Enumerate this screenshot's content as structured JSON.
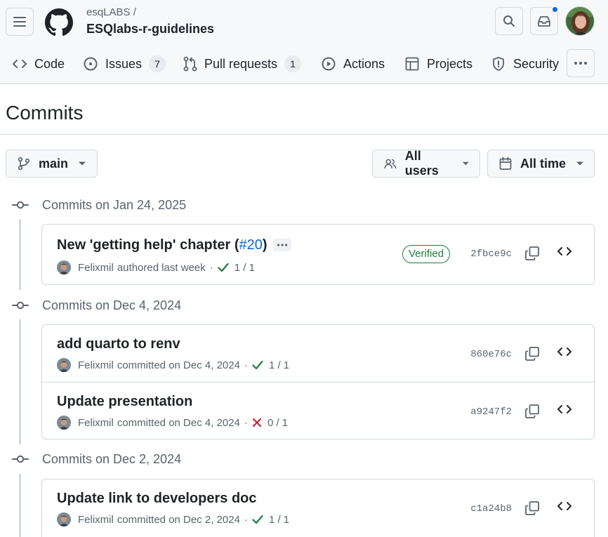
{
  "header": {
    "owner": "esqLABS /",
    "repo": "ESQlabs-r-guidelines"
  },
  "nav": {
    "code": "Code",
    "issues": "Issues",
    "issues_count": "7",
    "pulls": "Pull requests",
    "pulls_count": "1",
    "actions": "Actions",
    "projects": "Projects",
    "security": "Security"
  },
  "page": {
    "title": "Commits"
  },
  "filters": {
    "branch": "main",
    "users": "All users",
    "time": "All time"
  },
  "groups": [
    {
      "date_label": "Commits on Jan 24, 2025",
      "commits": [
        {
          "message": "New 'getting help' chapter (",
          "pr_link": "#20",
          "message_tail": ")",
          "author": "Felixmil",
          "action": "authored last week",
          "status": "success",
          "checks": "1 / 1",
          "verified": "Verified",
          "sha": "2fbce9c"
        }
      ]
    },
    {
      "date_label": "Commits on Dec 4, 2024",
      "commits": [
        {
          "message": "add quarto to renv",
          "author": "Felixmil",
          "action": "committed on Dec 4, 2024",
          "status": "success",
          "checks": "1 / 1",
          "sha": "860e76c"
        },
        {
          "message": "Update presentation",
          "author": "Felixmil",
          "action": "committed on Dec 4, 2024",
          "status": "failure",
          "checks": "0 / 1",
          "sha": "a9247f2"
        }
      ]
    },
    {
      "date_label": "Commits on Dec 2, 2024",
      "commits": [
        {
          "message": "Update link to developers doc",
          "author": "Felixmil",
          "action": "committed on Dec 2, 2024",
          "status": "success",
          "checks": "1 / 1",
          "sha": "c1a24b8"
        }
      ]
    }
  ],
  "colors": {
    "success": "#1a7f37",
    "failure": "#cf222e",
    "link": "#0969da",
    "notification": "#0969da"
  }
}
